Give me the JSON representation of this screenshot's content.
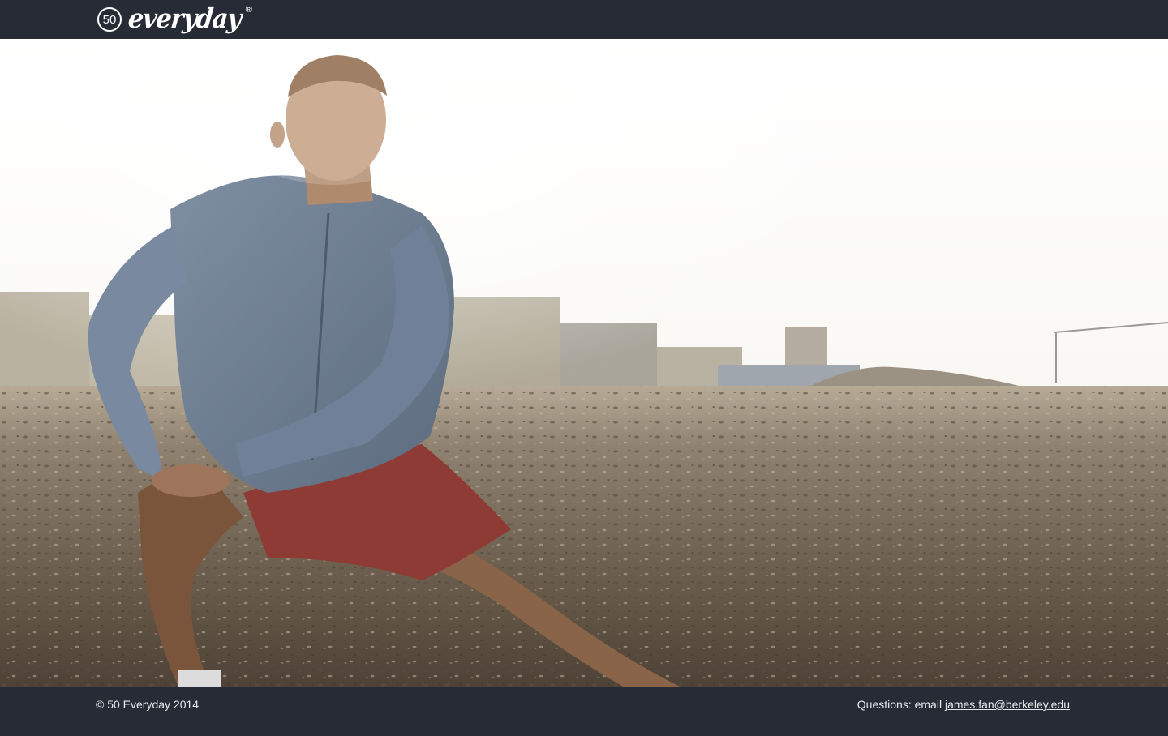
{
  "header": {
    "logo_number": "50",
    "logo_word": "everyday",
    "logo_mark": "®"
  },
  "hero": {
    "image": "man-stretching-lunge-on-gravel-lot"
  },
  "footer": {
    "copyright": "© 50 Everyday 2014",
    "contact_prefix": "Questions: email ",
    "contact_email": "james.fan@berkeley.edu"
  },
  "colors": {
    "bar_background": "#262b35",
    "bar_text": "#e8e9ec"
  }
}
